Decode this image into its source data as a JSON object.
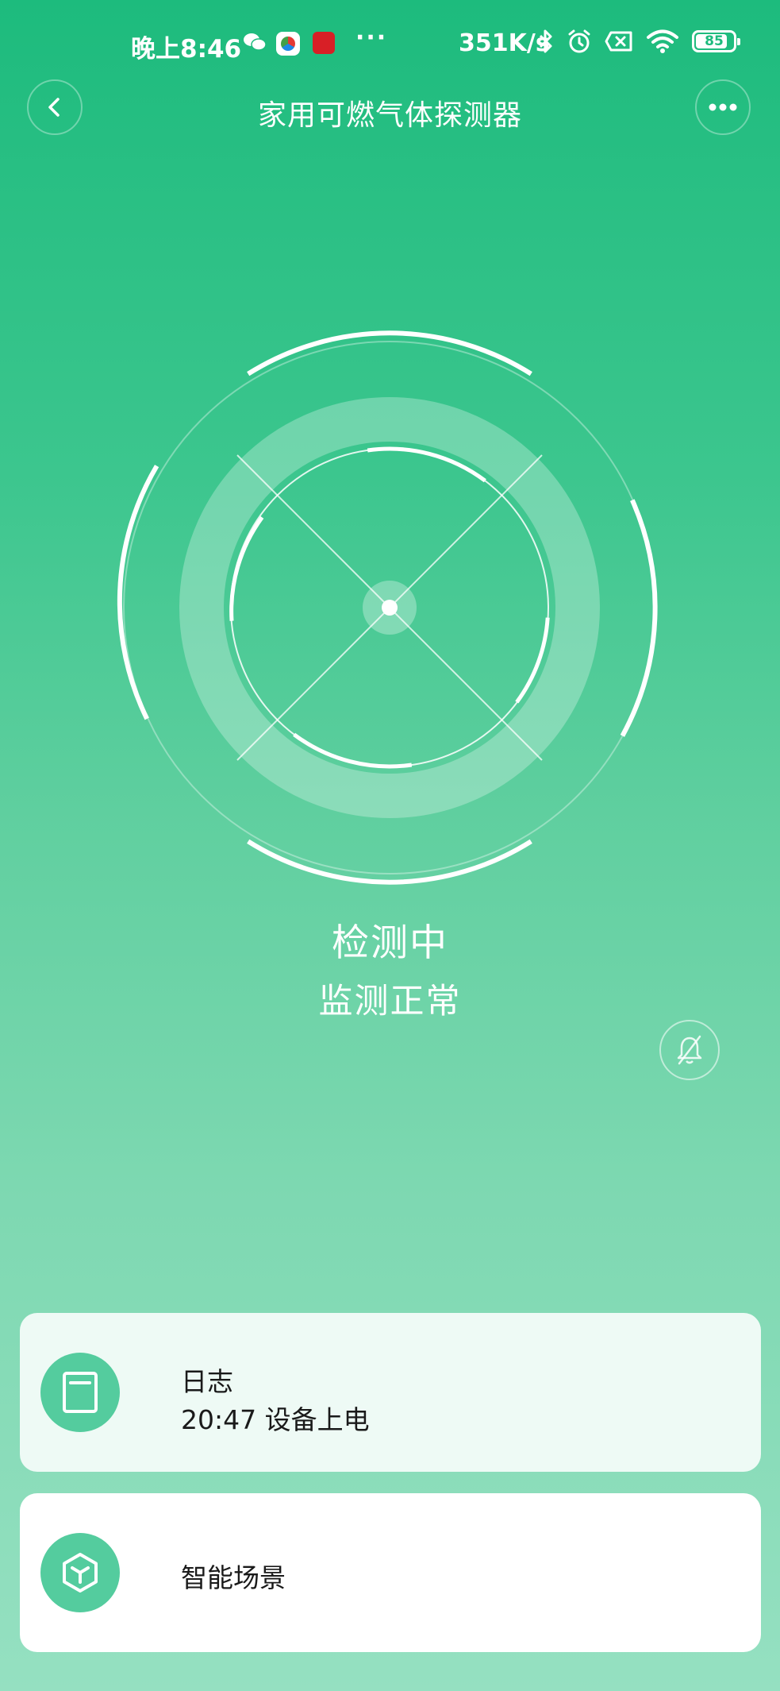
{
  "status_bar": {
    "time": "晚上8:46",
    "more": "···",
    "net_speed": "351K/s",
    "battery": "85",
    "battery_level": 0.85
  },
  "header": {
    "title": "家用可燃气体探测器"
  },
  "detector": {
    "status": "检测中",
    "detail": "监测正常"
  },
  "cards": {
    "log": {
      "title": "日志",
      "latest": "20:47 设备上电"
    },
    "scene": {
      "title": "智能场景"
    }
  },
  "colors": {
    "background_top": "#1dbb7d",
    "background_bottom": "#95e0c1",
    "card_icon": "#54cc9e",
    "text_dark": "#1a1a1a"
  },
  "icons": {
    "back": "chevron-left-icon",
    "more": "more-dots-icon",
    "mute": "bell-off-icon",
    "log": "notebook-icon",
    "scene": "cube-icon"
  }
}
